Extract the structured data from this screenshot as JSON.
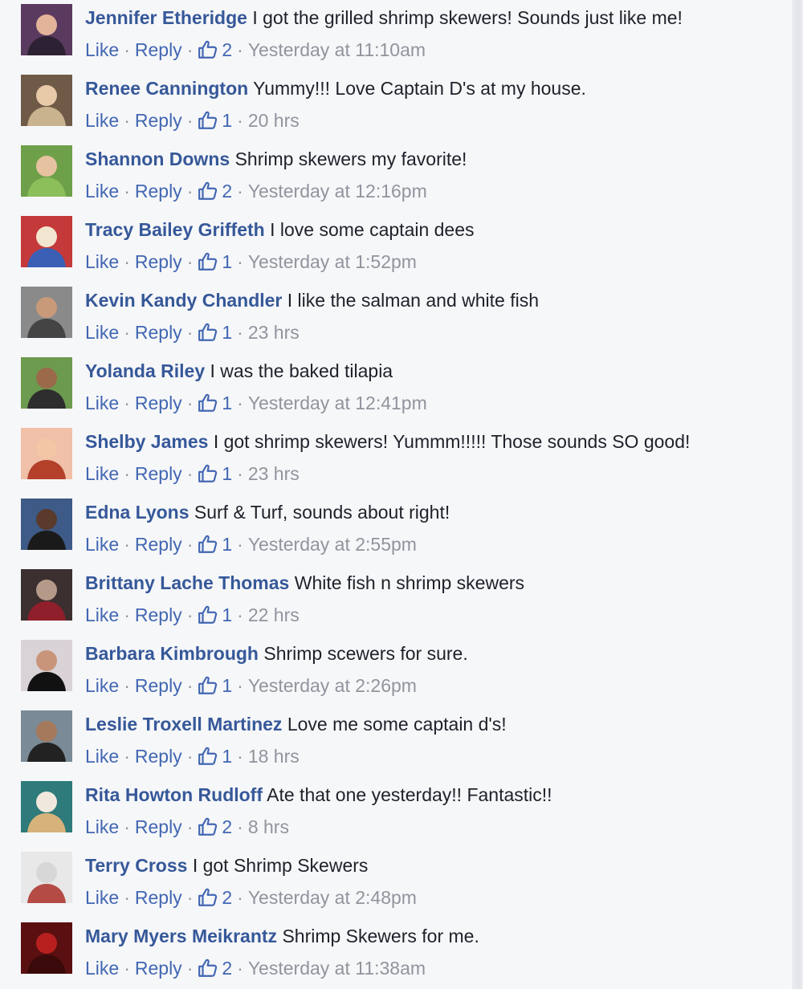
{
  "comments": [
    {
      "author": "Jennifer Etheridge",
      "text": "I got the grilled shrimp skewers! Sounds just like me!",
      "like_label": "Like",
      "reply_label": "Reply",
      "likes": "2",
      "time": "Yesterday at 11:10am"
    },
    {
      "author": "Renee Cannington",
      "text": "Yummy!!! Love Captain D's at my house.",
      "like_label": "Like",
      "reply_label": "Reply",
      "likes": "1",
      "time": "20 hrs"
    },
    {
      "author": "Shannon Downs",
      "text": "Shrimp skewers my favorite!",
      "like_label": "Like",
      "reply_label": "Reply",
      "likes": "2",
      "time": "Yesterday at 12:16pm"
    },
    {
      "author": "Tracy Bailey Griffeth",
      "text": "I love some captain dees",
      "like_label": "Like",
      "reply_label": "Reply",
      "likes": "1",
      "time": "Yesterday at 1:52pm"
    },
    {
      "author": "Kevin Kandy Chandler",
      "text": "I like the salman and white fish",
      "like_label": "Like",
      "reply_label": "Reply",
      "likes": "1",
      "time": "23 hrs"
    },
    {
      "author": "Yolanda Riley",
      "text": "I was the baked tilapia",
      "like_label": "Like",
      "reply_label": "Reply",
      "likes": "1",
      "time": "Yesterday at 12:41pm"
    },
    {
      "author": "Shelby James",
      "text": "I got shrimp skewers! Yummm!!!!! Those sounds SO good!",
      "like_label": "Like",
      "reply_label": "Reply",
      "likes": "1",
      "time": "23 hrs"
    },
    {
      "author": "Edna Lyons",
      "text": "Surf & Turf, sounds about right!",
      "like_label": "Like",
      "reply_label": "Reply",
      "likes": "1",
      "time": "Yesterday at 2:55pm"
    },
    {
      "author": "Brittany Lache Thomas",
      "text": "White fish n shrimp skewers",
      "like_label": "Like",
      "reply_label": "Reply",
      "likes": "1",
      "time": "22 hrs"
    },
    {
      "author": "Barbara Kimbrough",
      "text": "Shrimp scewers for sure.",
      "like_label": "Like",
      "reply_label": "Reply",
      "likes": "1",
      "time": "Yesterday at 2:26pm"
    },
    {
      "author": "Leslie Troxell Martinez",
      "text": "Love me some captain d's!",
      "like_label": "Like",
      "reply_label": "Reply",
      "likes": "1",
      "time": "18 hrs"
    },
    {
      "author": "Rita Howton Rudloff",
      "text": "Ate that one yesterday!! Fantastic!!",
      "like_label": "Like",
      "reply_label": "Reply",
      "likes": "2",
      "time": "8 hrs"
    },
    {
      "author": "Terry Cross",
      "text": "I got Shrimp Skewers",
      "like_label": "Like",
      "reply_label": "Reply",
      "likes": "2",
      "time": "Yesterday at 2:48pm"
    },
    {
      "author": "Mary Myers Meikrantz",
      "text": "Shrimp Skewers for me.",
      "like_label": "Like",
      "reply_label": "Reply",
      "likes": "2",
      "time": "Yesterday at 11:38am"
    }
  ],
  "colors": {
    "author": "#365899",
    "action": "#4267b2",
    "meta": "#90949c",
    "text": "#1d2129",
    "background": "#f6f7f9"
  },
  "icons": {
    "like_count": "thumbs-up-icon",
    "avatar": "profile-photo"
  }
}
